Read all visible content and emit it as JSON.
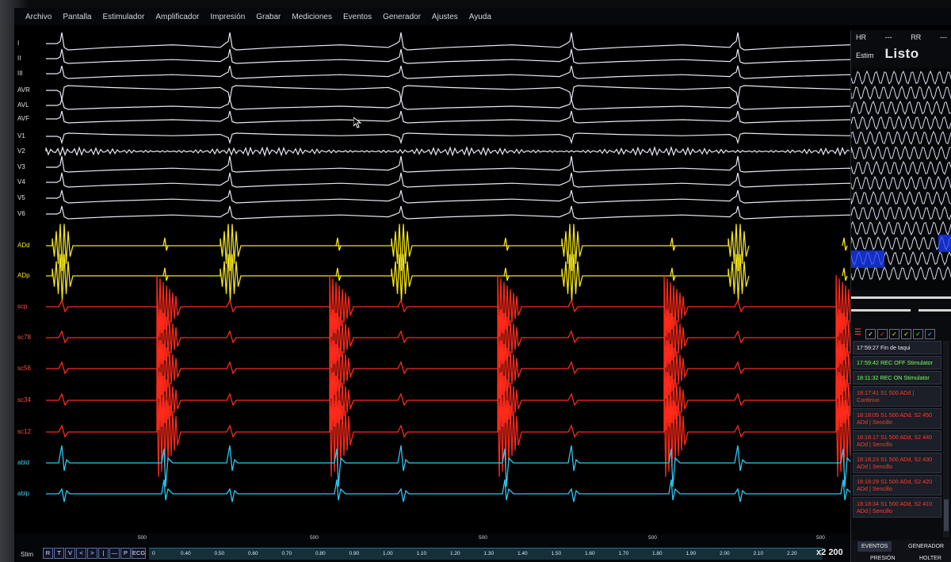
{
  "menu": [
    "Archivo",
    "Pantalla",
    "Estimulador",
    "Amplificador",
    "Impresión",
    "Grabar",
    "Mediciones",
    "Eventos",
    "Generador",
    "Ajustes",
    "Ayuda"
  ],
  "channels": [
    "I",
    "II",
    "III",
    "AVR",
    "AVL",
    "AVF",
    "V1",
    "V2",
    "V3",
    "V4",
    "V5",
    "V6",
    "ADd",
    "ADp",
    "scp",
    "sc78",
    "sc56",
    "sc34",
    "sc12",
    "abld",
    "ablp"
  ],
  "colors": {
    "ecg": "#e8e8f4",
    "atrial": "#f2e51a",
    "cs": "#ff2a1a",
    "ablation": "#2ec8f0",
    "background": "#000000"
  },
  "right_panel": {
    "hr_label": "HR",
    "hr_value": "---",
    "rr_label": "RR",
    "rr_value": "---",
    "estim_label": "Estim",
    "status": "Listo"
  },
  "toolbar": {
    "menu_icon": "list-icon"
  },
  "events": [
    {
      "text": "17:59:27 Fin de taqui",
      "color": "white"
    },
    {
      "text": "17:59:42 REC OFF Stimulator",
      "color": "green"
    },
    {
      "text": "18:11:32 REC ON Stimulator",
      "color": "green"
    },
    {
      "text": "18:17:41 S1 500 ADd | Continuo",
      "color": "red"
    },
    {
      "text": "18:18:05 S1 500 ADd, S2 450 ADd | Sencillo",
      "color": "red"
    },
    {
      "text": "18:18:17 S1 500 ADd, S2 440 ADd | Sencillo",
      "color": "red"
    },
    {
      "text": "18:18:23 S1 500 ADd, S2 430 ADd | Sencillo",
      "color": "red"
    },
    {
      "text": "18:18:29 S1 500 ADd, S2 420 ADd | Sencillo",
      "color": "red"
    },
    {
      "text": "18:18:34 S1 500 ADd, S2 410 ADd | Sencillo",
      "color": "red"
    }
  ],
  "tabs": {
    "eventos": "EVENTOS",
    "generador": "GENERADOR",
    "presion": "PRESIÓN",
    "holter": "HOLTER"
  },
  "bottom": {
    "stim_label": "Stim",
    "buttons": [
      "R",
      "T",
      "V",
      "<",
      ">",
      "|",
      "—",
      "P",
      "ECG"
    ],
    "s1_label": "500",
    "time_ticks": [
      "0",
      "0.40",
      "0.50",
      "0.60",
      "0.70",
      "0.80",
      "0.90",
      "1.00",
      "1.10",
      "1.20",
      "1.30",
      "1.40",
      "1.50",
      "1.60",
      "1.70",
      "1.80",
      "1.90",
      "2.00",
      "2.10",
      "2.20"
    ],
    "zoom_label": "x2",
    "speed_label": "200"
  }
}
